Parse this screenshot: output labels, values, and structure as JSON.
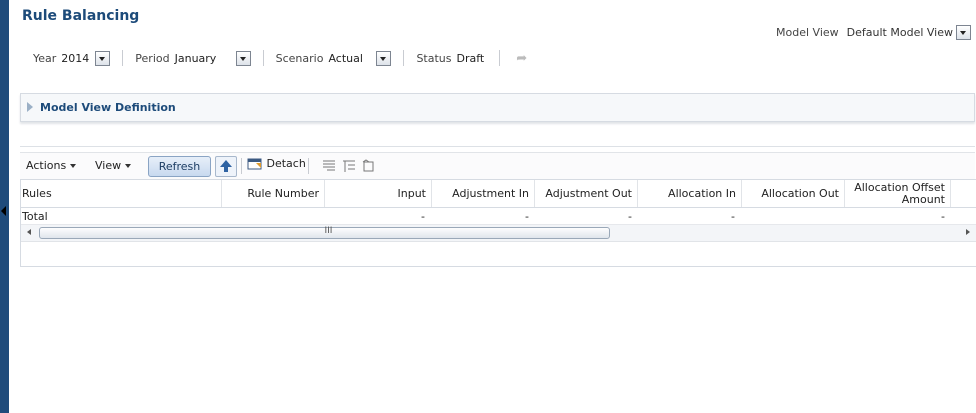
{
  "title": "Rule Balancing",
  "filters": {
    "year_label": "Year",
    "year_value": "2014",
    "period_label": "Period",
    "period_value": "January",
    "scenario_label": "Scenario",
    "scenario_value": "Actual",
    "status_label": "Status",
    "status_value": "Draft"
  },
  "model_view": {
    "label": "Model View",
    "value": "Default Model View"
  },
  "panel": {
    "title": "Model View Definition"
  },
  "toolbar": {
    "actions": "Actions",
    "view": "View",
    "refresh": "Refresh",
    "detach": "Detach"
  },
  "table": {
    "columns": [
      "Rules",
      "Rule Number",
      "Input",
      "Adjustment In",
      "Adjustment Out",
      "Allocation In",
      "Allocation Out",
      "Allocation Offset Amount"
    ],
    "rows": [
      {
        "rules": "Total",
        "rule_number": "",
        "input": "-",
        "adjustment_in": "-",
        "adjustment_out": "-",
        "allocation_in": "-",
        "allocation_out": "",
        "allocation_offset": "-"
      }
    ],
    "scroll_grip": "III"
  },
  "colors": {
    "sidebar": "#1f4b7b",
    "title": "#1d4b7a",
    "accent": "#c8d9ef"
  }
}
